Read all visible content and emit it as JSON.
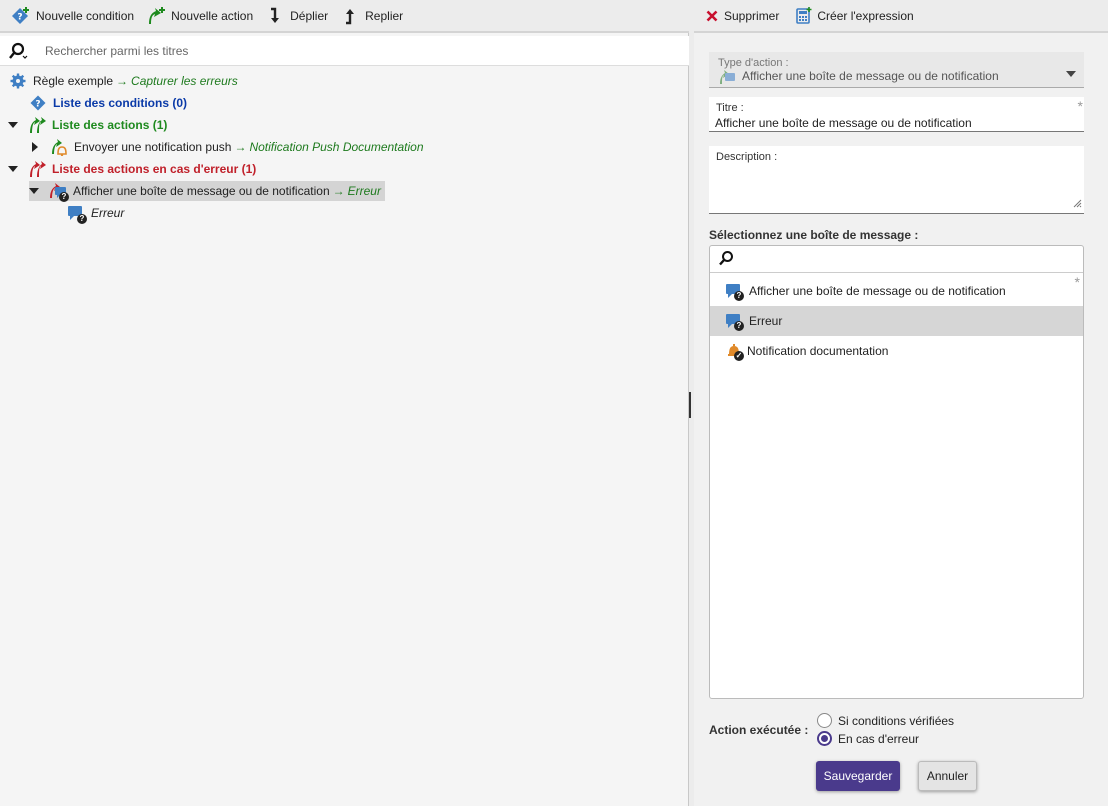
{
  "left_toolbar": {
    "new_condition": "Nouvelle condition",
    "new_action": "Nouvelle action",
    "expand": "Déplier",
    "collapse": "Replier"
  },
  "search": {
    "placeholder": "Rechercher parmi les titres"
  },
  "tree": {
    "root": {
      "label": "Règle exemple",
      "arrow": "→",
      "sub": "Capturer les erreurs"
    },
    "conditions": {
      "label": "Liste des conditions (0)"
    },
    "actions": {
      "label": "Liste des actions (1)"
    },
    "action_item": {
      "label": "Envoyer une notification push",
      "arrow": "→",
      "sub": "Notification Push Documentation"
    },
    "error_actions": {
      "label": "Liste des actions en cas d'erreur (1)"
    },
    "error_item": {
      "label": "Afficher une boîte de message ou de notification",
      "arrow": "→",
      "sub": "Erreur"
    },
    "error_child": {
      "label": "Erreur"
    }
  },
  "right_toolbar": {
    "delete": "Supprimer",
    "create_expression": "Créer l'expression"
  },
  "form": {
    "type_label": "Type d'action :",
    "type_value": "Afficher une boîte de message ou de notification",
    "title_label": "Titre :",
    "title_value": "Afficher une boîte de message ou de notification",
    "required_mark": "*",
    "description_label": "Description :",
    "select_label": "Sélectionnez une boîte de message :",
    "list": [
      {
        "label": "Afficher une boîte de message ou de notification"
      },
      {
        "label": "Erreur"
      },
      {
        "label": "Notification documentation"
      }
    ],
    "exec_label": "Action exécutée :",
    "radio_conditions": "Si conditions vérifiées",
    "radio_error": "En cas d'erreur",
    "save": "Sauvegarder",
    "cancel": "Annuler"
  },
  "colors": {
    "accent": "#4a3a8c",
    "conditions": "#0a3aa8",
    "actions": "#1e8a1e",
    "errors": "#c0202a",
    "delete": "#c8102e"
  }
}
